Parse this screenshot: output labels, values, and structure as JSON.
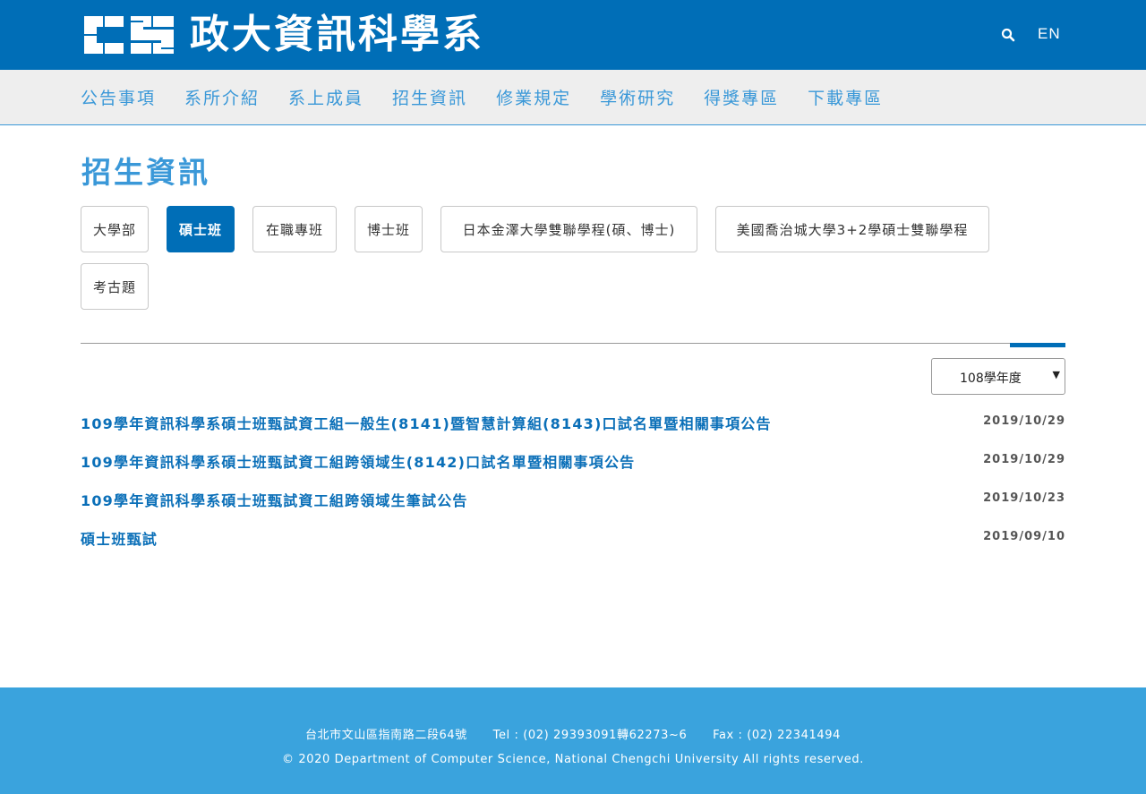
{
  "header": {
    "logo_text": "政大資訊科學系",
    "lang_label": "EN"
  },
  "nav": {
    "items": [
      "公告事項",
      "系所介紹",
      "系上成員",
      "招生資訊",
      "修業規定",
      "學術研究",
      "得獎專區",
      "下載專區"
    ]
  },
  "main": {
    "title": "招生資訊",
    "tabs": [
      {
        "label": "大學部",
        "active": false
      },
      {
        "label": "碩士班",
        "active": true
      },
      {
        "label": "在職專班",
        "active": false
      },
      {
        "label": "博士班",
        "active": false
      },
      {
        "label": "日本金澤大學雙聯學程(碩、博士)",
        "active": false
      },
      {
        "label": "美國喬治城大學3+2學碩士雙聯學程",
        "active": false
      },
      {
        "label": "考古題",
        "active": false
      }
    ],
    "year_select": {
      "value": "108學年度"
    },
    "news": [
      {
        "title": "109學年資訊科學系碩士班甄試資工組一般生(8141)暨智慧計算組(8143)口試名單暨相關事項公告",
        "date": "2019/10/29"
      },
      {
        "title": "109學年資訊科學系碩士班甄試資工組跨領域生(8142)口試名單暨相關事項公告",
        "date": "2019/10/29"
      },
      {
        "title": "109學年資訊科學系碩士班甄試資工組跨領域生筆試公告",
        "date": "2019/10/23"
      },
      {
        "title": "碩士班甄試",
        "date": "2019/09/10"
      }
    ]
  },
  "footer": {
    "address": "台北市文山區指南路二段64號",
    "tel": "Tel : (02) 29393091轉62273~6",
    "fax": "Fax : (02) 22341494",
    "copyright": "© 2020 Department of Computer Science, National Chengchi University All rights reserved."
  },
  "colors": {
    "primary": "#006eb7",
    "nav_text": "#3a98d8",
    "footer_bg": "#3aa3dd"
  }
}
